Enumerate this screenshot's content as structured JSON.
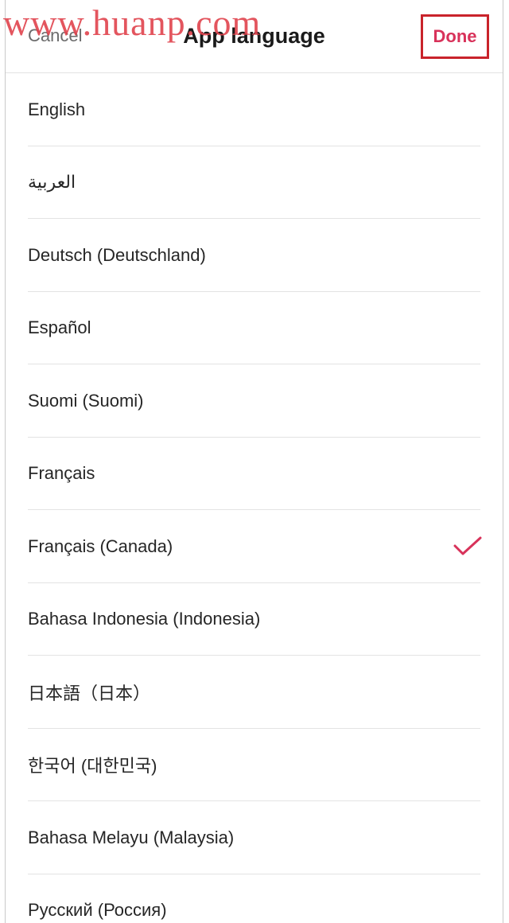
{
  "watermark": "www.huanp.com",
  "header": {
    "cancel_label": "Cancel",
    "title": "App language",
    "done_label": "Done"
  },
  "languages": [
    {
      "label": "English",
      "selected": false
    },
    {
      "label": "العربية",
      "selected": false
    },
    {
      "label": "Deutsch (Deutschland)",
      "selected": false
    },
    {
      "label": "Español",
      "selected": false
    },
    {
      "label": "Suomi (Suomi)",
      "selected": false
    },
    {
      "label": "Français",
      "selected": false
    },
    {
      "label": "Français (Canada)",
      "selected": true
    },
    {
      "label": "Bahasa Indonesia (Indonesia)",
      "selected": false
    },
    {
      "label": "日本語（日本）",
      "selected": false
    },
    {
      "label": "한국어 (대한민국)",
      "selected": false
    },
    {
      "label": "Bahasa Melayu (Malaysia)",
      "selected": false
    },
    {
      "label": "Русский (Россия)",
      "selected": false
    }
  ],
  "colors": {
    "accent": "#d8325a",
    "highlight_box": "#c9232b",
    "watermark": "#e0434d"
  },
  "icons": {
    "selected": "checkmark-icon"
  }
}
